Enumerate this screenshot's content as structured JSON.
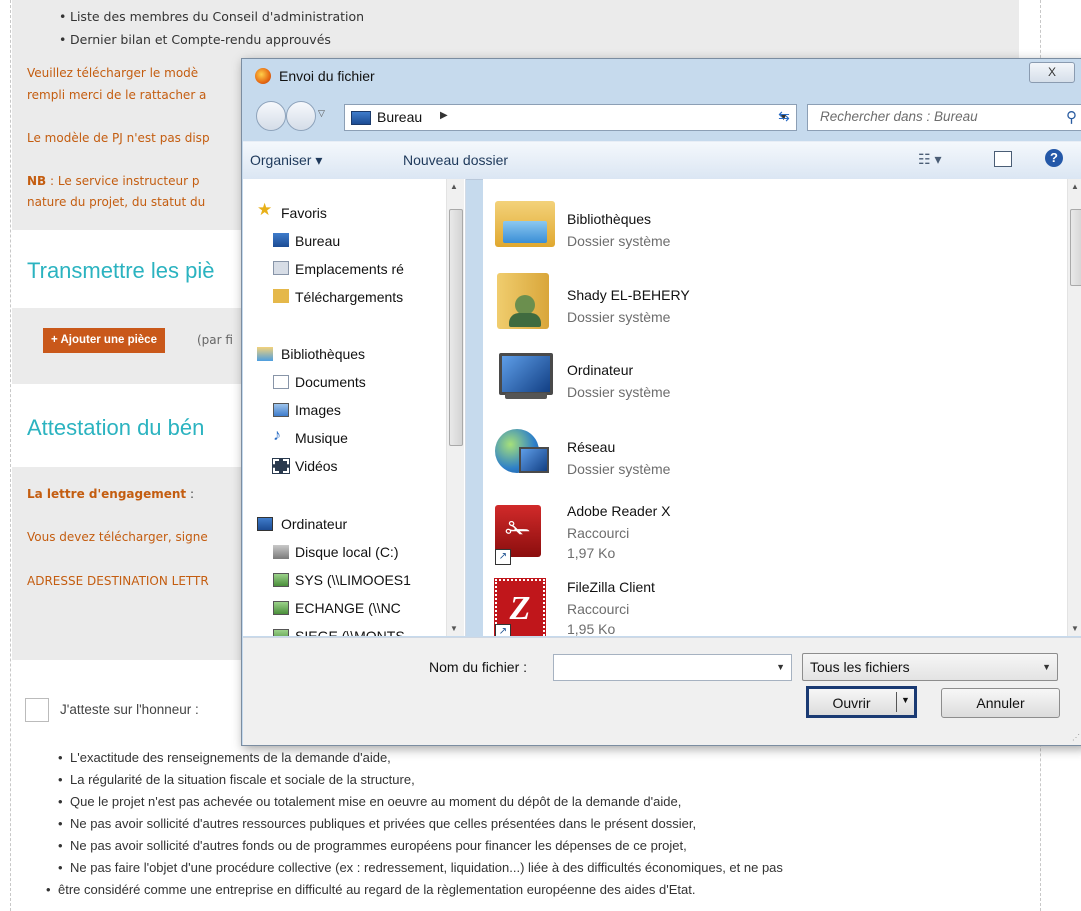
{
  "page": {
    "top_bullets": [
      "Liste des membres du Conseil d'administration",
      "Dernier bilan et Compte-rendu approuvés"
    ],
    "para1_line1": "Veuillez télécharger le modè",
    "para1_line2": "rempli merci de le rattacher a",
    "para2": "Le modèle de PJ n'est pas disp",
    "nb_label": "NB",
    "nb_line1": " : Le service instructeur p",
    "nb_line2": "nature du projet, du statut du",
    "section1_title": "Transmettre les piè",
    "add_button": "+ Ajouter une pièce",
    "add_hint": "(par fi",
    "section2_title": "Attestation du bén",
    "letter_label": "La lettre d'engagement",
    "letter_colon": " :",
    "letter_text": "Vous devez télécharger, signe",
    "address_text": "ADRESSE DESTINATION LETTR",
    "attest_text": "J'atteste sur l'honneur :",
    "bullets": [
      "L'exactitude des renseignements de la demande d'aide,",
      "La régularité de la situation fiscale et sociale de la structure,",
      "Que le projet n'est pas achevée ou totalement mise en oeuvre au moment du dépôt de la demande d'aide,",
      "Ne pas avoir sollicité d'autres ressources publiques et privées que celles présentées dans le présent dossier,",
      "Ne pas avoir sollicité d'autres fonds ou de programmes européens pour financer les dépenses de ce projet,",
      "Ne pas faire l'objet d'une procédure collective (ex : redressement, liquidation...) liée à des difficultés économiques, et ne pas",
      "être considéré comme une entreprise en difficulté au regard de la règlementation européenne des aides d'Etat."
    ],
    "colors": {
      "orange": "#c9581a",
      "teal": "#2bb3c0"
    }
  },
  "dialog": {
    "title": "Envoi du fichier",
    "close": "X",
    "address": "Bureau",
    "search_placeholder": "Rechercher dans : Bureau",
    "toolbar": {
      "organize": "Organiser ▾",
      "new_folder": "Nouveau dossier"
    },
    "nav": {
      "favorites": "Favoris",
      "bureau": "Bureau",
      "emplacements": "Emplacements ré",
      "downloads": "Téléchargements",
      "libraries": "Bibliothèques",
      "documents": "Documents",
      "images": "Images",
      "music": "Musique",
      "videos": "Vidéos",
      "computer": "Ordinateur",
      "disk": "Disque local (C:)",
      "sys": "SYS (\\\\LIMOOES1",
      "echange": "ECHANGE (\\\\NC",
      "siege": "SIEGE (\\\\MONTS"
    },
    "files": [
      {
        "name": "Bibliothèques",
        "sub": "Dossier système",
        "icon": "libraries-folder-icon"
      },
      {
        "name": "Shady EL-BEHERY",
        "sub": "Dossier système",
        "icon": "user-folder-icon"
      },
      {
        "name": "Ordinateur",
        "sub": "Dossier système",
        "icon": "computer-icon"
      },
      {
        "name": "Réseau",
        "sub": "Dossier système",
        "icon": "network-icon"
      },
      {
        "name": "Adobe Reader X",
        "sub": "Raccourci",
        "size": "1,97 Ko",
        "icon": "adobe-reader-icon"
      },
      {
        "name": "FileZilla Client",
        "sub": "Raccourci",
        "size": "1,95 Ko",
        "icon": "filezilla-icon"
      }
    ],
    "filename_label": "Nom du fichier :",
    "filename_value": "",
    "filetype": "Tous les fichiers",
    "open_button": "Ouvrir",
    "cancel_button": "Annuler"
  }
}
